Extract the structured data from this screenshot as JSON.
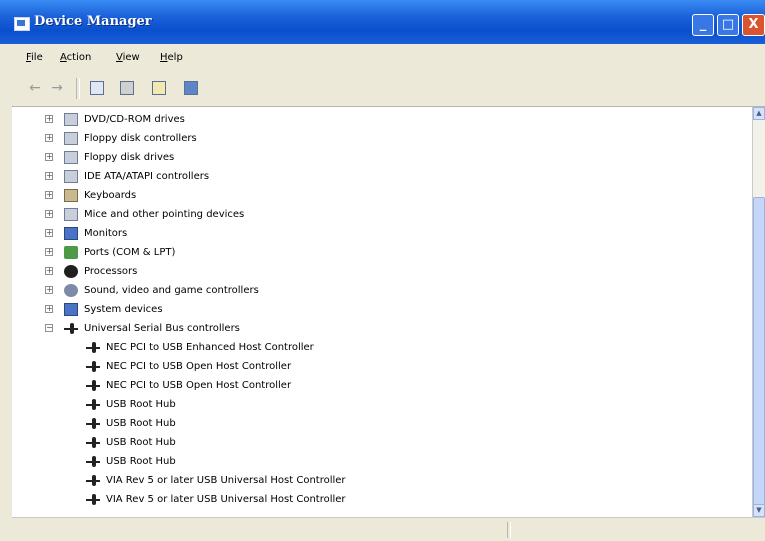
{
  "window": {
    "title": "Device Manager",
    "minimize_label": "_",
    "maximize_label": "□",
    "close_label": "X"
  },
  "menu": {
    "file": "File",
    "action": "Action",
    "view": "View",
    "help": "Help"
  },
  "toolbar": {
    "back_label": "←",
    "forward_label": "→",
    "icons": [
      "properties-icon",
      "print-icon",
      "help-icon",
      "scan-hardware-icon"
    ]
  },
  "tree": {
    "categories": [
      {
        "label": "DVD/CD-ROM drives",
        "expander": "+",
        "icon": "dvd-icon"
      },
      {
        "label": "Floppy disk controllers",
        "expander": "+",
        "icon": "floppy-controller-icon"
      },
      {
        "label": "Floppy disk drives",
        "expander": "+",
        "icon": "floppy-drive-icon"
      },
      {
        "label": "IDE ATA/ATAPI controllers",
        "expander": "+",
        "icon": "ide-icon"
      },
      {
        "label": "Keyboards",
        "expander": "+",
        "icon": "keyboard-icon"
      },
      {
        "label": "Mice and other pointing devices",
        "expander": "+",
        "icon": "mouse-icon"
      },
      {
        "label": "Monitors",
        "expander": "+",
        "icon": "monitor-icon"
      },
      {
        "label": "Ports (COM & LPT)",
        "expander": "+",
        "icon": "port-icon"
      },
      {
        "label": "Processors",
        "expander": "+",
        "icon": "processor-icon"
      },
      {
        "label": "Sound, video and game controllers",
        "expander": "+",
        "icon": "sound-icon"
      },
      {
        "label": "System devices",
        "expander": "+",
        "icon": "system-icon"
      },
      {
        "label": "Universal Serial Bus controllers",
        "expander": "−",
        "icon": "usb-icon"
      }
    ],
    "usb_children": [
      "NEC PCI to USB Enhanced Host Controller",
      "NEC PCI to USB Open Host Controller",
      "NEC PCI to USB Open Host Controller",
      "USB Root Hub",
      "USB Root Hub",
      "USB Root Hub",
      "USB Root Hub",
      "VIA Rev 5 or later USB Universal Host Controller",
      "VIA Rev 5 or later USB Universal Host Controller"
    ]
  },
  "colors": {
    "titlebar": "#0a4fcc",
    "chrome": "#ece9d8",
    "close_button": "#d9542f"
  }
}
